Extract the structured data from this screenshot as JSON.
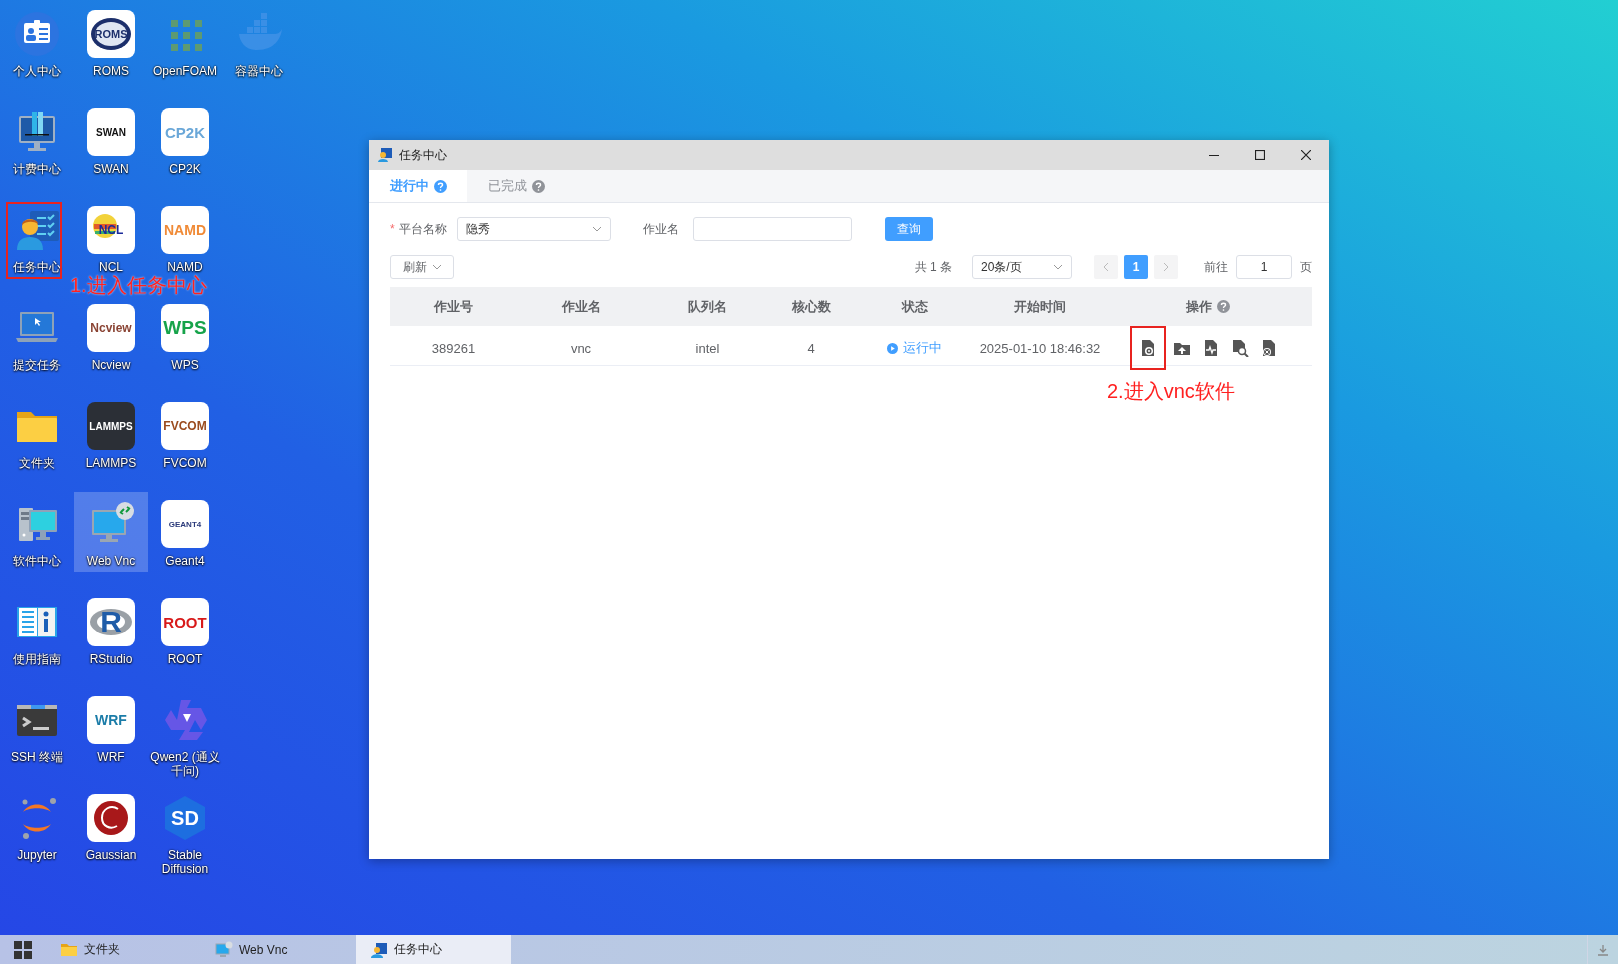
{
  "desktop": {
    "rows": [
      {
        "icons": [
          {
            "label": "个人中心",
            "selected": false,
            "framed": false
          },
          {
            "label": "ROMS",
            "logo_text": "ROMS",
            "selected": false,
            "framed": false
          },
          {
            "label": "OpenFOAM",
            "selected": false,
            "framed": false
          },
          {
            "label": "容器中心",
            "selected": false,
            "framed": false
          }
        ]
      },
      {
        "icons": [
          {
            "label": "计费中心",
            "selected": false,
            "framed": false
          },
          {
            "label": "SWAN",
            "logo_text": "SWAN",
            "selected": false,
            "framed": false
          },
          {
            "label": "CP2K",
            "logo_text": "CP2K",
            "selected": false,
            "framed": false
          }
        ]
      },
      {
        "icons": [
          {
            "label": "任务中心",
            "selected": false,
            "framed": true
          },
          {
            "label": "NCL",
            "logo_text": "NCL",
            "selected": false,
            "framed": false
          },
          {
            "label": "NAMD",
            "logo_text": "NAMD",
            "selected": false,
            "framed": false
          }
        ]
      },
      {
        "icons": [
          {
            "label": "提交任务",
            "selected": false,
            "framed": false
          },
          {
            "label": "Ncview",
            "logo_text": "Ncview",
            "selected": false,
            "framed": false
          },
          {
            "label": "WPS",
            "logo_text": "WPS",
            "selected": false,
            "framed": false
          }
        ]
      },
      {
        "icons": [
          {
            "label": "文件夹",
            "selected": false,
            "framed": false
          },
          {
            "label": "LAMMPS",
            "logo_text": "LAMMPS",
            "selected": false,
            "framed": false
          },
          {
            "label": "FVCOM",
            "logo_text": "FVCOM",
            "selected": false,
            "framed": false
          }
        ]
      },
      {
        "icons": [
          {
            "label": "软件中心",
            "selected": false,
            "framed": false
          },
          {
            "label": "Web Vnc",
            "selected": true,
            "framed": false
          },
          {
            "label": "Geant4",
            "logo_text": "GEANT4",
            "selected": false,
            "framed": false
          }
        ]
      },
      {
        "icons": [
          {
            "label": "使用指南",
            "selected": false,
            "framed": false
          },
          {
            "label": "RStudio",
            "logo_text": "R",
            "selected": false,
            "framed": false
          },
          {
            "label": "ROOT",
            "logo_text": "ROOT",
            "selected": false,
            "framed": false
          }
        ]
      },
      {
        "icons": [
          {
            "label": "SSH 终端",
            "selected": false,
            "framed": false
          },
          {
            "label": "WRF",
            "logo_text": "WRF",
            "selected": false,
            "framed": false
          },
          {
            "label": "Qwen2 (通义千问)",
            "selected": false,
            "framed": false
          }
        ]
      },
      {
        "icons": [
          {
            "label": "Jupyter",
            "selected": false,
            "framed": false
          },
          {
            "label": "Gaussian",
            "selected": false,
            "framed": false
          },
          {
            "label": "Stable Diffusion",
            "logo_text": "SD",
            "selected": false,
            "framed": false
          }
        ]
      }
    ]
  },
  "annotations": [
    {
      "text": "1.进入任务中心"
    },
    {
      "text": "2.进入vnc软件"
    }
  ],
  "window": {
    "title": "任务中心",
    "tabs": [
      {
        "label": "进行中",
        "selected": true,
        "help": true
      },
      {
        "label": "已完成",
        "selected": false,
        "help": true
      }
    ],
    "filters": {
      "platform": {
        "required_mark": "*",
        "label": "平台名称",
        "value": "隐秀"
      },
      "job_name": {
        "label": "作业名"
      },
      "query_button": "查询"
    },
    "refresh_button": "刷新",
    "pagination": {
      "total": "共 1 条",
      "page_size": "20条/页",
      "pages": [
        {
          "label": "1",
          "selected": true
        }
      ],
      "goto_label": "前往",
      "goto_value": "1",
      "page_suffix": "页"
    },
    "table": {
      "columns": [
        {
          "label": "作业号"
        },
        {
          "label": "作业名"
        },
        {
          "label": "队列名"
        },
        {
          "label": "核心数"
        },
        {
          "label": "状态"
        },
        {
          "label": "开始时间"
        },
        {
          "label": "操作",
          "help": true
        }
      ],
      "rows": [
        {
          "job_id": "389261",
          "job_name": "vnc",
          "queue": "intel",
          "cores": "4",
          "status": {
            "text": "运行中",
            "running": true
          },
          "start_time": "2025-01-10 18:46:32",
          "actions": [
            {
              "framed": true
            },
            {
              "framed": false
            },
            {
              "framed": false
            },
            {
              "framed": false
            },
            {
              "framed": false
            }
          ]
        }
      ]
    }
  },
  "taskbar": {
    "items": [
      {
        "label": "文件夹",
        "selected": false
      },
      {
        "label": "Web Vnc",
        "selected": false
      },
      {
        "label": "任务中心",
        "selected": true
      }
    ]
  }
}
